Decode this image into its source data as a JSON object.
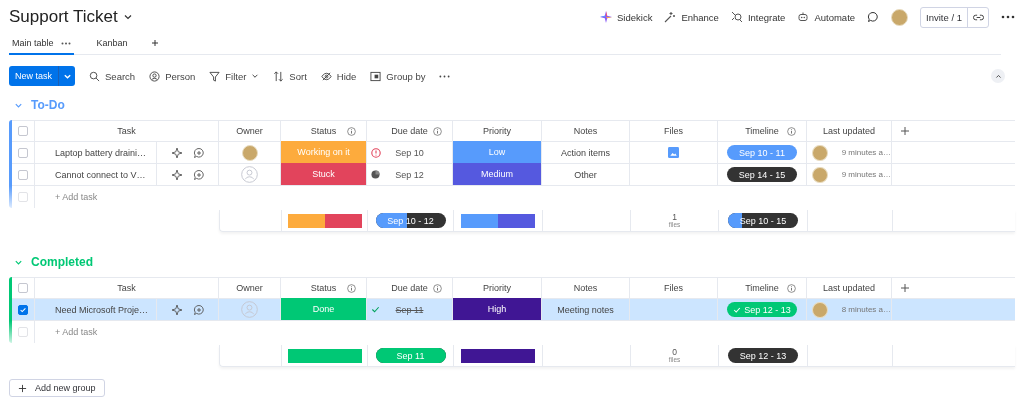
{
  "board": {
    "title": "Support Ticket"
  },
  "views": [
    {
      "label": "Main table",
      "selected": true,
      "has_menu": true
    },
    {
      "label": "Kanban",
      "selected": false,
      "has_menu": false
    }
  ],
  "header_actions": [
    {
      "kind": "sidekick",
      "label": "Sidekick"
    },
    {
      "kind": "enhance",
      "label": "Enhance"
    },
    {
      "kind": "integrate",
      "label": "Integrate"
    },
    {
      "kind": "automate",
      "label": "Automate"
    }
  ],
  "invite": {
    "label": "Invite / 1"
  },
  "toolbar": {
    "primary": "New task",
    "items": [
      {
        "kind": "search",
        "label": "Search",
        "caret": false
      },
      {
        "kind": "person",
        "label": "Person",
        "caret": false
      },
      {
        "kind": "filter",
        "label": "Filter",
        "caret": true
      },
      {
        "kind": "sort",
        "label": "Sort",
        "caret": false
      },
      {
        "kind": "hide",
        "label": "Hide",
        "caret": false
      },
      {
        "kind": "group",
        "label": "Group by",
        "caret": false
      }
    ]
  },
  "groups": [
    {
      "name": "To-Do",
      "color": "#579bfc",
      "expanded": true,
      "header_checked": false,
      "new_row_checked": false,
      "columns": [
        {
          "label": "Task",
          "info": false
        },
        {
          "label": "Owner",
          "info": false
        },
        {
          "label": "Status",
          "info": true
        },
        {
          "label": "Due date",
          "info": true
        },
        {
          "label": "Priority",
          "info": false
        },
        {
          "label": "Notes",
          "info": false
        },
        {
          "label": "Files",
          "info": false
        },
        {
          "label": "Timeline",
          "info": true
        },
        {
          "label": "Last updated",
          "info": false
        }
      ],
      "rows": [
        {
          "task": "Laptop battery draini…",
          "selected": false,
          "assigned": true,
          "status": {
            "label": "Working on it",
            "color": "#fdab3d"
          },
          "due": {
            "text": "Sep 10",
            "kind": "overdue"
          },
          "priority": {
            "label": "Low",
            "color": "#579bfc"
          },
          "notes": "Action items",
          "file": true,
          "timeline": {
            "text": "Sep 10 - 11",
            "color": "#579bfc",
            "done": false
          },
          "updated": "9 minutes a…"
        },
        {
          "task": "Cannot connect to V…",
          "selected": false,
          "assigned": false,
          "status": {
            "label": "Stuck",
            "color": "#e2445c"
          },
          "due": {
            "text": "Sep 12",
            "kind": "progress"
          },
          "priority": {
            "label": "Medium",
            "color": "#5559df"
          },
          "notes": "Other",
          "file": false,
          "timeline": {
            "text": "Sep 14 - 15",
            "color": "#333333",
            "done": false
          },
          "updated": "9 minutes a…"
        }
      ],
      "add_task": "+ Add task",
      "summary": {
        "status": [
          {
            "color": "#fdab3d"
          },
          {
            "color": "#e2445c"
          }
        ],
        "due": {
          "text": "Sep 10 - 12",
          "color": "#579bfc",
          "level": 0.45
        },
        "priority": [
          {
            "color": "#579bfc"
          },
          {
            "color": "#5559df"
          }
        ],
        "files": {
          "count": "1",
          "label": "files"
        },
        "timeline": {
          "text": "Sep 10 - 15",
          "color": "#579bfc",
          "level": 0.2
        }
      }
    },
    {
      "name": "Completed",
      "color": "#00c875",
      "expanded": true,
      "header_checked": false,
      "new_row_checked": false,
      "columns": [
        {
          "label": "Task",
          "info": false
        },
        {
          "label": "Owner",
          "info": false
        },
        {
          "label": "Status",
          "info": true
        },
        {
          "label": "Due date",
          "info": true
        },
        {
          "label": "Priority",
          "info": false
        },
        {
          "label": "Notes",
          "info": false
        },
        {
          "label": "Files",
          "info": false
        },
        {
          "label": "Timeline",
          "info": true
        },
        {
          "label": "Last updated",
          "info": false
        }
      ],
      "rows": [
        {
          "task": "Need Microsoft Proje…",
          "selected": true,
          "assigned": false,
          "status": {
            "label": "Done",
            "color": "#00c875"
          },
          "due": {
            "text": "Sep 11",
            "kind": "done"
          },
          "priority": {
            "label": "High",
            "color": "#401694"
          },
          "notes": "Meeting notes",
          "file": false,
          "timeline": {
            "text": "Sep 12 - 13",
            "color": "#00c875",
            "done": true
          },
          "updated": "8 minutes a…"
        }
      ],
      "add_task": "+ Add task",
      "summary": {
        "status": [
          {
            "color": "#00c875"
          }
        ],
        "due": {
          "text": "Sep 11",
          "color": "#00c875",
          "level": 1
        },
        "priority": [
          {
            "color": "#401694"
          }
        ],
        "files": {
          "count": "0",
          "label": "files"
        },
        "timeline": {
          "text": "Sep 12 - 13",
          "level": 0
        }
      }
    }
  ],
  "add_group": {
    "label": "Add new group"
  }
}
